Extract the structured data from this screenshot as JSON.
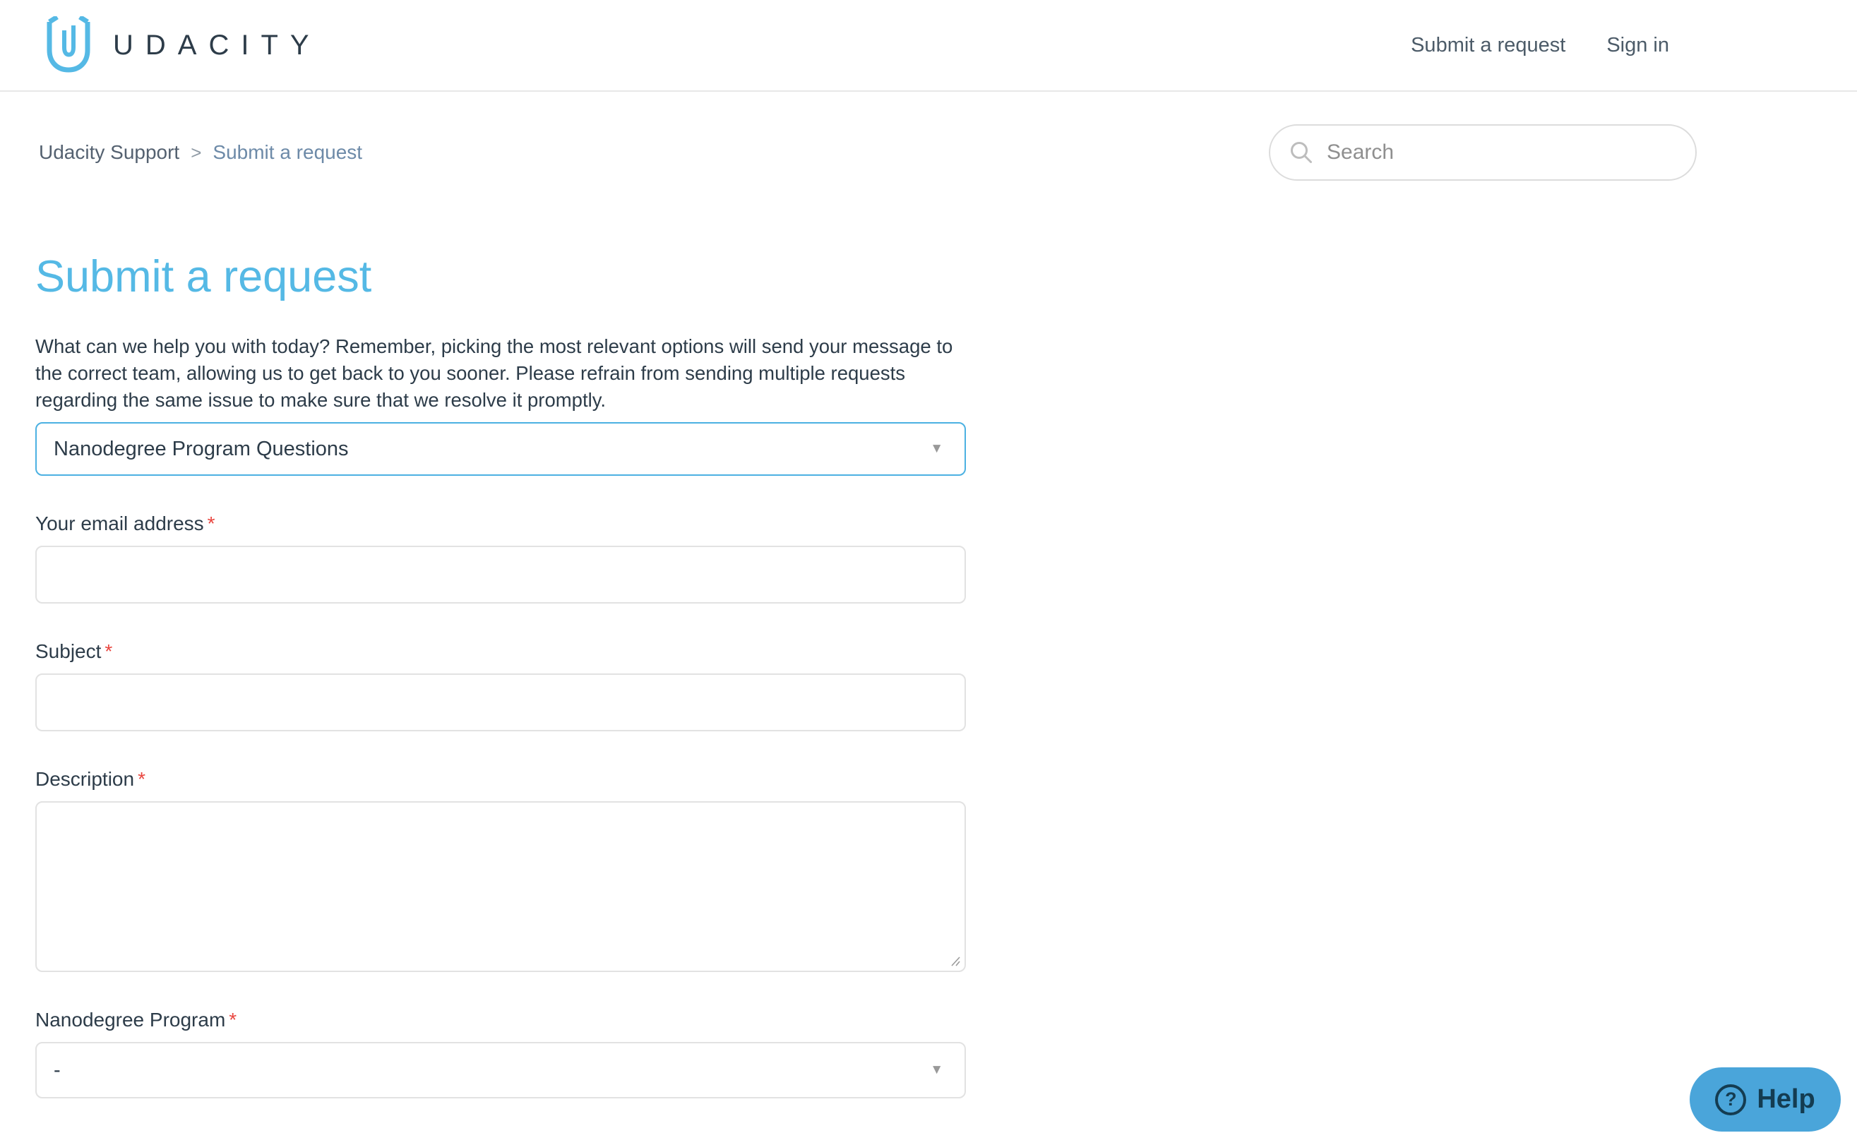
{
  "header": {
    "logo_text": "UDACITY",
    "nav": [
      {
        "label": "Submit a request"
      },
      {
        "label": "Sign in"
      }
    ]
  },
  "breadcrumb": {
    "separator": ">",
    "items": [
      "Udacity Support",
      "Submit a request"
    ]
  },
  "search": {
    "placeholder": "Search"
  },
  "page": {
    "title": "Submit a request",
    "intro": "What can we help you with today? Remember, picking the most relevant options will send your message to the correct team, allowing us to get back to you sooner. Please refrain from sending multiple requests regarding the same issue to make sure that we resolve it promptly."
  },
  "form": {
    "required_marker": "*",
    "category": {
      "value": "Nanodegree Program Questions"
    },
    "email": {
      "label": "Your email address",
      "value": "",
      "required": true
    },
    "subject": {
      "label": "Subject",
      "value": "",
      "required": true
    },
    "description": {
      "label": "Description",
      "value": "",
      "required": true
    },
    "program": {
      "label": "Nanodegree Program",
      "value": "-",
      "required": true
    }
  },
  "help_widget": {
    "label": "Help"
  },
  "colors": {
    "brand_blue": "#55b9e5",
    "focus_border": "#4cb1e2",
    "text_dark": "#2d3c49",
    "required_red": "#e9463f",
    "help_bg": "#4aa5da",
    "help_fg": "#143c51"
  }
}
